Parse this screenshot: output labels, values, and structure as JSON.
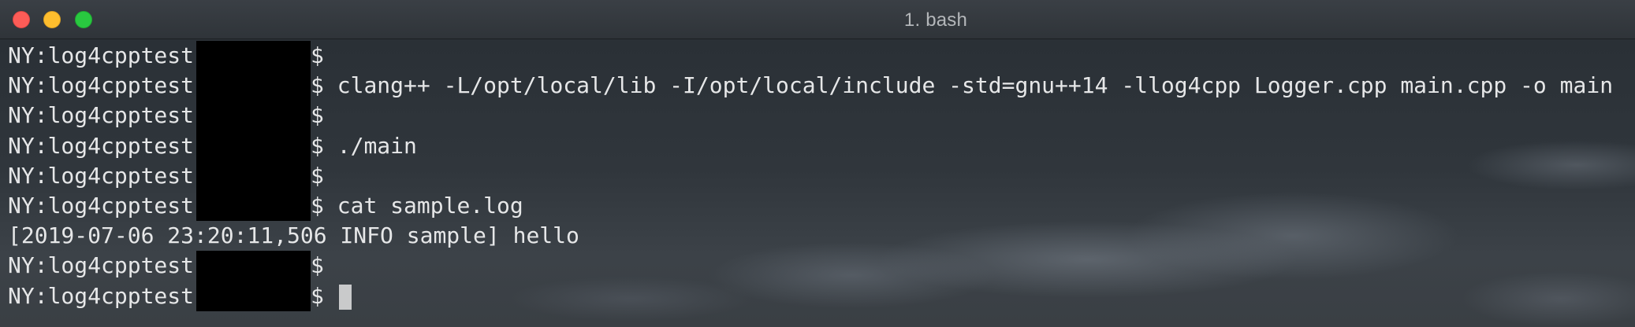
{
  "window": {
    "title": "1. bash",
    "buttons": [
      "close",
      "minimize",
      "zoom"
    ]
  },
  "terminal": {
    "prompt": "NY:log4cpptest",
    "lines": [
      {
        "type": "prompt",
        "command": ""
      },
      {
        "type": "prompt",
        "command": "clang++ -L/opt/local/lib -I/opt/local/include -std=gnu++14 -llog4cpp Logger.cpp main.cpp -o main"
      },
      {
        "type": "prompt",
        "command": ""
      },
      {
        "type": "prompt",
        "command": "./main"
      },
      {
        "type": "prompt",
        "command": ""
      },
      {
        "type": "prompt",
        "command": "cat sample.log"
      },
      {
        "type": "output",
        "text": "[2019-07-06 23:20:11,506 INFO sample] hello"
      },
      {
        "type": "prompt",
        "command": ""
      },
      {
        "type": "prompt",
        "command": "",
        "cursor": true
      }
    ]
  },
  "colors": {
    "close": "#fc5c57",
    "minimize": "#fdbd2e",
    "zoom": "#29c840",
    "text": "#e6e7e8"
  }
}
